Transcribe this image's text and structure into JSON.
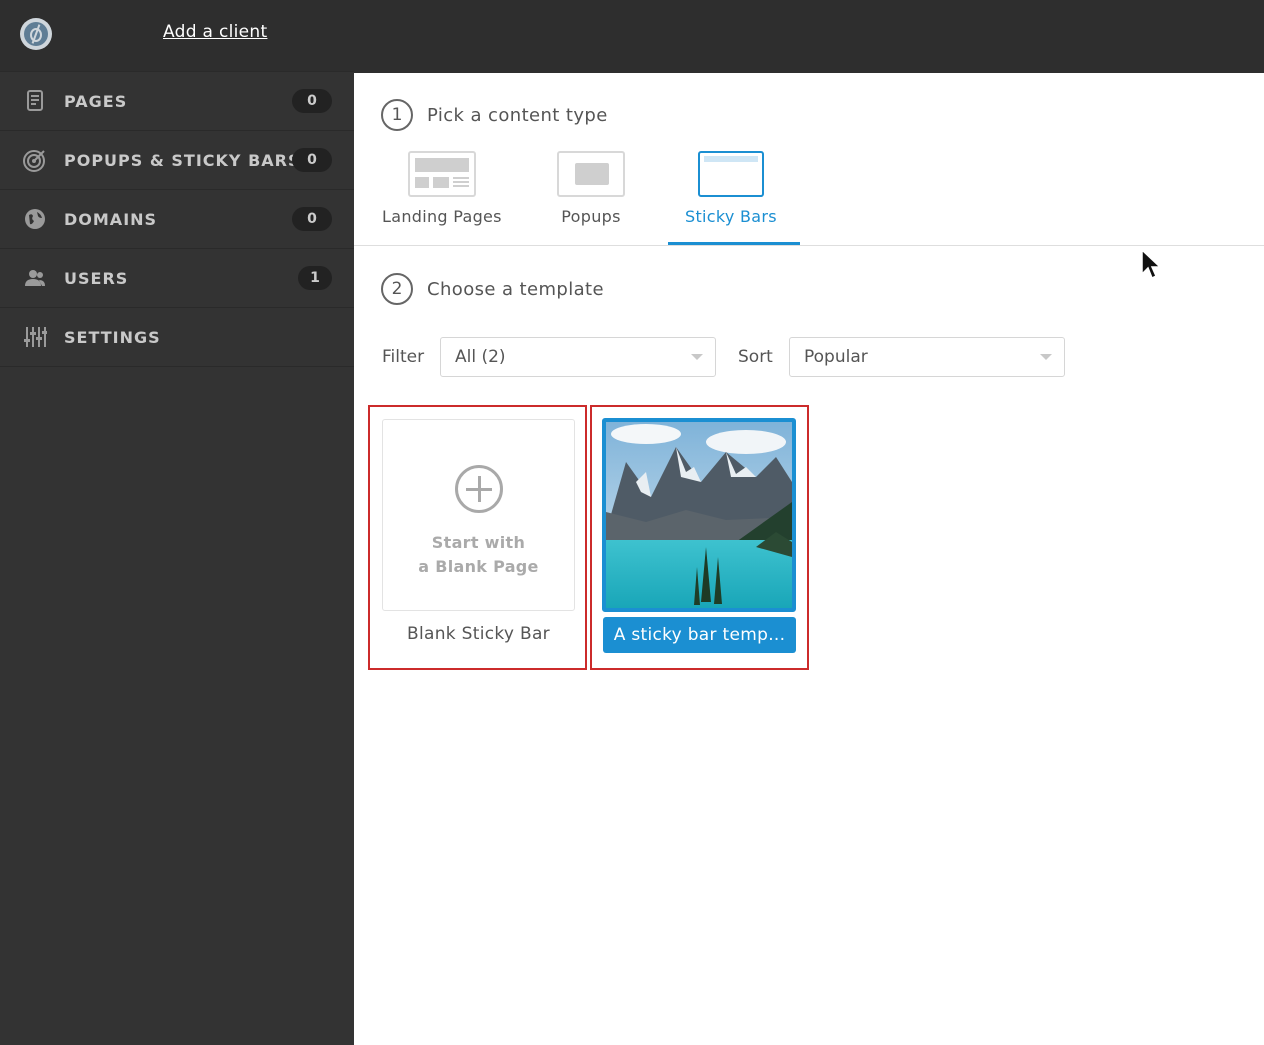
{
  "header": {
    "add_client": "Add a client"
  },
  "sidebar": {
    "items": [
      {
        "label": "PAGES",
        "count": "0",
        "icon": "pages-icon"
      },
      {
        "label": "POPUPS & STICKY BARS",
        "count": "0",
        "icon": "target-icon"
      },
      {
        "label": "DOMAINS",
        "count": "0",
        "icon": "globe-icon"
      },
      {
        "label": "USERS",
        "count": "1",
        "icon": "users-icon"
      },
      {
        "label": "SETTINGS",
        "count": "",
        "icon": "sliders-icon"
      }
    ]
  },
  "step1": {
    "number": "1",
    "title": "Pick a content type"
  },
  "content_types": [
    {
      "label": "Landing Pages",
      "active": false
    },
    {
      "label": "Popups",
      "active": false
    },
    {
      "label": "Sticky Bars",
      "active": true
    }
  ],
  "step2": {
    "number": "2",
    "title": "Choose a template"
  },
  "filter": {
    "label": "Filter",
    "value": "All (2)"
  },
  "sort": {
    "label": "Sort",
    "value": "Popular"
  },
  "templates": {
    "blank": {
      "line1": "Start with",
      "line2": "a Blank Page",
      "caption": "Blank Sticky Bar"
    },
    "mountain": {
      "caption": "A sticky bar temp..."
    }
  },
  "colors": {
    "accent": "#1b8fd2",
    "sidebar": "#333333",
    "highlight": "#cc2b2b"
  }
}
